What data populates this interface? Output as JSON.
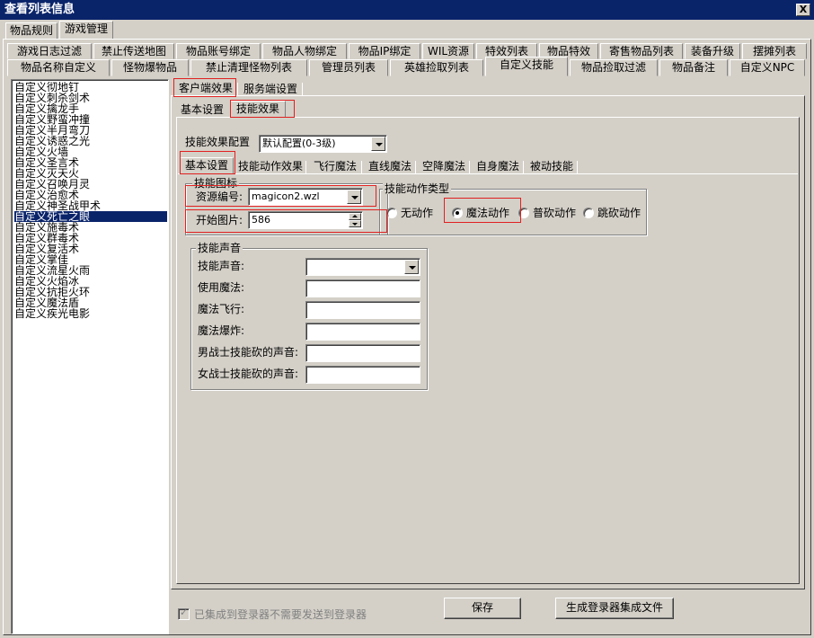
{
  "window": {
    "title": "查看列表信息",
    "close_label": "X"
  },
  "top_tabs": [
    {
      "label": "物品规则",
      "active": false
    },
    {
      "label": "游戏管理",
      "active": true
    }
  ],
  "tab_row1": [
    "游戏日志过滤",
    "禁止传送地图",
    "物品账号绑定",
    "物品人物绑定",
    "物品IP绑定",
    "WIL资源",
    "特效列表",
    "物品特效",
    "寄售物品列表",
    "装备升级",
    "摆摊列表"
  ],
  "tab_row2": [
    "物品名称自定义",
    "怪物爆物品",
    "禁止清理怪物列表",
    "管理员列表",
    "英雄捡取列表",
    "自定义技能",
    "物品捡取过滤",
    "物品备注",
    "自定义NPC"
  ],
  "tab_row2_active": "自定义技能",
  "skill_list": {
    "items": [
      "自定义彻地钉",
      "自定义刺杀剑术",
      "自定义擒龙手",
      "自定义野蛮冲撞",
      "自定义半月弯刀",
      "自定义诱惑之光",
      "自定义火墙",
      "自定义圣言术",
      "自定义灭天火",
      "自定义召唤月灵",
      "自定义治愈术",
      "自定义神圣战甲术",
      "自定义死亡之眼",
      "自定义施毒术",
      "自定义群毒术",
      "自定义复活术",
      "自定义掌佳",
      "自定义流星火雨",
      "自定义火焰冰",
      "自定义抗拒火环",
      "自定义魔法盾",
      "自定义疾光电影"
    ],
    "selected_index": 12
  },
  "effect_tabs": [
    "客户端效果",
    "服务端设置"
  ],
  "sub_tabs": [
    "基本设置",
    "技能效果"
  ],
  "effect_config": {
    "label": "技能效果配置",
    "value": "默认配置(0-3级)"
  },
  "magic_tabs": [
    "基本设置",
    "技能动作效果",
    "飞行魔法",
    "直线魔法",
    "空降魔法",
    "自身魔法",
    "被动技能"
  ],
  "skill_icon": {
    "group_label": "技能图标",
    "resource_label": "资源编号:",
    "resource_value": "magicon2.wzl",
    "start_label": "开始图片:",
    "start_value": "586"
  },
  "action_type": {
    "group_label": "技能动作类型",
    "options": [
      "无动作",
      "魔法动作",
      "普砍动作",
      "跳砍动作"
    ],
    "selected": "魔法动作"
  },
  "sound": {
    "group_label": "技能声音",
    "fields": [
      {
        "label": "技能声音:",
        "value": ""
      },
      {
        "label": "使用魔法:",
        "value": ""
      },
      {
        "label": "魔法飞行:",
        "value": ""
      },
      {
        "label": "魔法爆炸:",
        "value": ""
      },
      {
        "label": "男战士技能砍的声音:",
        "value": ""
      },
      {
        "label": "女战士技能砍的声音:",
        "value": ""
      }
    ]
  },
  "footer": {
    "checkbox_label": "已集成到登录器不需要发送到登录器",
    "save_label": "保存",
    "generate_label": "生成登录器集成文件"
  }
}
